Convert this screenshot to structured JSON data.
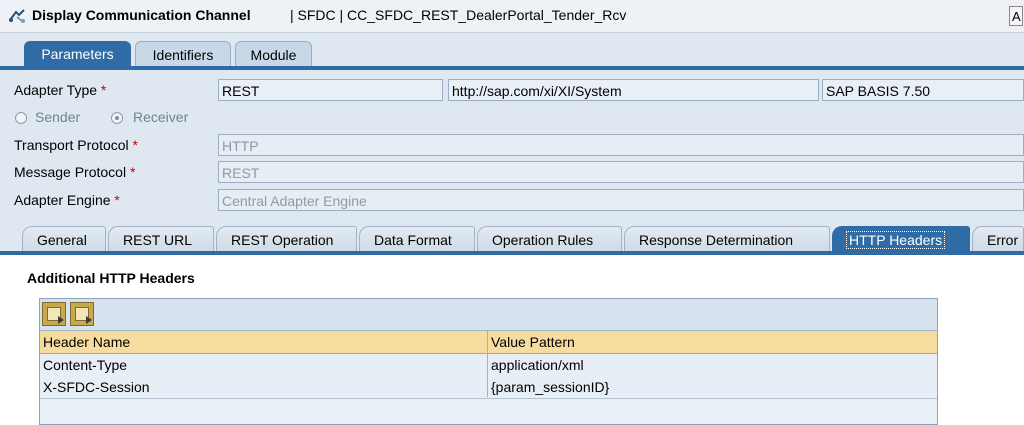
{
  "window": {
    "title": "Display Communication Channel",
    "path": "| SFDC | CC_SFDC_REST_DealerPortal_Tender_Rcv",
    "corner_button": "A"
  },
  "top_tabs": [
    {
      "label": "Parameters",
      "active": true
    },
    {
      "label": "Identifiers",
      "active": false
    },
    {
      "label": "Module",
      "active": false
    }
  ],
  "params": {
    "adapter_type_label": "Adapter Type",
    "adapter_type_value": "REST",
    "adapter_namespace": "http://sap.com/xi/XI/System",
    "adapter_swcv": "SAP BASIS 7.50",
    "sender_label": "Sender",
    "receiver_label": "Receiver",
    "receiver_selected": true,
    "transport_protocol_label": "Transport Protocol",
    "transport_protocol_value": "HTTP",
    "message_protocol_label": "Message Protocol",
    "message_protocol_value": "REST",
    "adapter_engine_label": "Adapter Engine",
    "adapter_engine_value": "Central Adapter Engine",
    "required_marker": "*"
  },
  "sub_tabs": [
    {
      "label": "General",
      "active": false
    },
    {
      "label": "REST URL",
      "active": false
    },
    {
      "label": "REST Operation",
      "active": false
    },
    {
      "label": "Data Format",
      "active": false
    },
    {
      "label": "Operation Rules",
      "active": false
    },
    {
      "label": "Response Determination",
      "active": false
    },
    {
      "label": "HTTP Headers",
      "active": true
    },
    {
      "label": "Error",
      "active": false
    }
  ],
  "headers_section": {
    "title": "Additional HTTP Headers",
    "columns": [
      "Header Name",
      "Value Pattern"
    ],
    "rows": [
      {
        "name": "Content-Type",
        "value": "application/xml"
      },
      {
        "name": "X-SFDC-Session",
        "value": "{param_sessionID}"
      }
    ],
    "toolbar_icons": [
      "insert-row-icon",
      "delete-row-icon"
    ]
  },
  "colors": {
    "accent": "#2f6ba4",
    "background": "#dfe8f1",
    "grid_header": "#f7dca0",
    "required": "#cc0000"
  }
}
